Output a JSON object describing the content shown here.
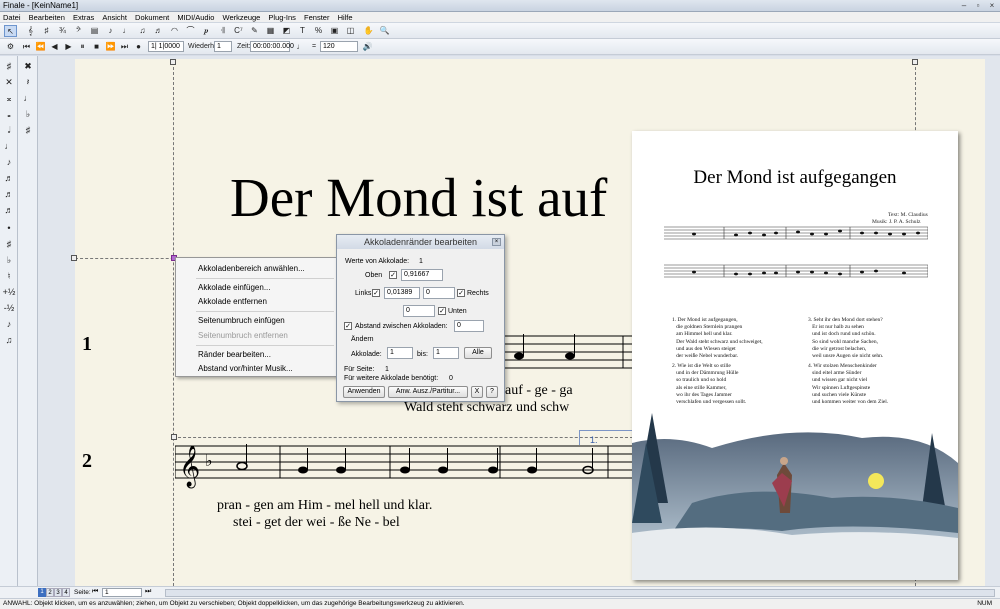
{
  "window": {
    "title": "Finale - [KeinName1]"
  },
  "menu": [
    "Datei",
    "Bearbeiten",
    "Extras",
    "Ansicht",
    "Dokument",
    "MIDI/Audio",
    "Werkzeuge",
    "Plug-Ins",
    "Fenster",
    "Hilfe"
  ],
  "playback": {
    "measure": "1| 1|0000",
    "repeat_label": "Wiederh.:",
    "repeat_value": "1",
    "time_label": "Zeit:",
    "time_value": "00:00:00.000",
    "eq": "=",
    "tempo": "120"
  },
  "score": {
    "title": "Der Mond ist auf",
    "staff_numbers": [
      "1",
      "2"
    ],
    "lyrics1_top": "auf   -   ge   -   ga",
    "lyrics1_bottom": "Wald  steht  schwarz  und  schw",
    "lyrics2_top": "pran  -  gen   am     Him - mel  hell   und    klar.",
    "lyrics2_bottom": "stei  -  get   der     wei  -  ße   Ne  -  bel",
    "ending": "1."
  },
  "context_menu": {
    "items": [
      "Akkoladenbereich anwählen...",
      "Akkolade einfügen...",
      "Akkolade entfernen",
      "Seitenumbruch einfügen",
      "Seitenumbruch entfernen",
      "Ränder bearbeiten...",
      "Abstand vor/hinter Musik..."
    ]
  },
  "dialog": {
    "title": "Akkoladenränder bearbeiten",
    "werte_label": "Werte von Akkolade:",
    "werte_value": "1",
    "oben_label": "Oben",
    "oben_value": "0,91667",
    "links_label": "Links",
    "links_value": "0,01389",
    "rechts_value": "0",
    "rechts_label": "Rechts",
    "unten_value": "0",
    "unten_label": "Unten",
    "abstand_label": "Abstand zwischen Akkoladen:",
    "abstand_value": "0",
    "aendern_label": "Ändern",
    "akkolade_label": "Akkolade:",
    "akkolade_from": "1",
    "bis_label": "bis:",
    "akkolade_to": "1",
    "alle_label": "Alle",
    "fuer_seite_label": "Für Seite:",
    "fuer_seite_value": "1",
    "weitere_label": "Für weitere Akkolade benötigt:",
    "weitere_value": "0",
    "anwenden": "Anwenden",
    "anw_ausz": "Anw. Ausz./Partitur...",
    "x": "X",
    "help": "?"
  },
  "preview": {
    "title": "Der Mond ist aufgegangen",
    "credit1": "Text: M. Claudius",
    "credit2": "Musik: J. P. A. Schulz",
    "verse1": "1. Der Mond ist aufgegangen,\n   die goldnen Sternlein prangen\n   am Himmel hell und klar.\n   Der Wald steht schwarz und schweiget,\n   und aus den Wiesen steiget\n   der weiße Nebel wunderbar.",
    "verse2": "2. Wie ist die Welt so stille\n   und in der Dämmrung Hülle\n   so traulich und so hold\n   als eine stille Kammer,\n   wo ihr des Tages Jammer\n   verschlafen und vergessen sollt.",
    "verse3": "3. Seht ihr den Mond dort stehen?\n   Er ist nur halb zu sehen\n   und ist doch rund und schön.\n   So sind wohl manche Sachen,\n   die wir getrost belachen,\n   weil unsre Augen sie nicht sehn.",
    "verse4": "4. Wir stolzen Menschenkinder\n   sind eitel arme Sünder\n   und wissen gar nicht viel\n   Wir spinnen Luftgespinste\n   und suchen viele Künste\n   und kommen weiter von dem Ziel."
  },
  "status": {
    "page_label": "Seite:",
    "page_value": "1",
    "num": "NUM"
  },
  "hint": "ANWAHL: Objekt klicken, um es anzuwählen; ziehen, um Objekt zu verschieben; Objekt doppelklicken, um das zugehörige Bearbeitungswerkzeug zu aktivieren."
}
